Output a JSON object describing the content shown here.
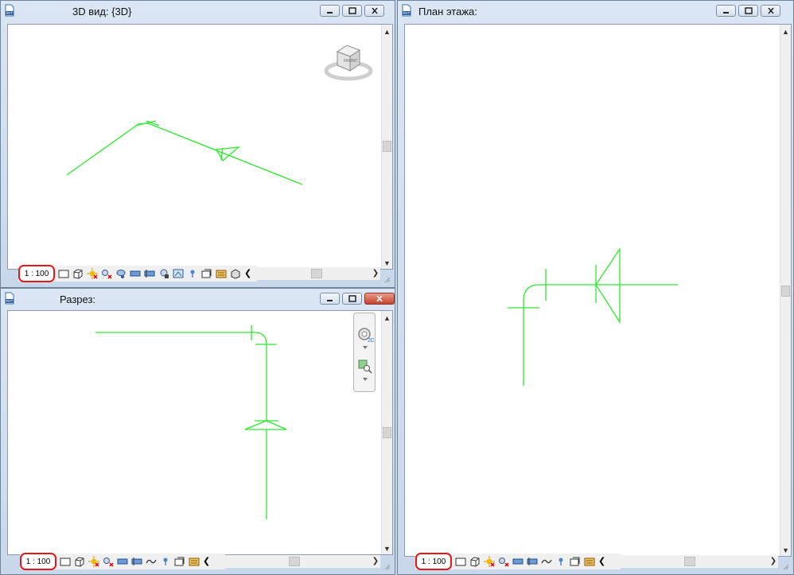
{
  "windows": {
    "view3d": {
      "title": "3D вид: {3D}",
      "scale": "1 : 100"
    },
    "section": {
      "title": "Разрез:",
      "scale": "1 : 100"
    },
    "plan": {
      "title": "План этажа:",
      "scale": "1 : 100"
    }
  },
  "app_icon_label": "RVT",
  "viewcube_label": "FRONT",
  "navbar_label": "2D",
  "colors": {
    "pipe": "#2ee82e",
    "scale_border": "#e01a1a"
  },
  "icons": [
    "revit-file-icon",
    "minimize-icon",
    "restore-icon",
    "close-icon",
    "viewcube-icon",
    "steering-wheel-icon",
    "zoom-region-icon"
  ]
}
